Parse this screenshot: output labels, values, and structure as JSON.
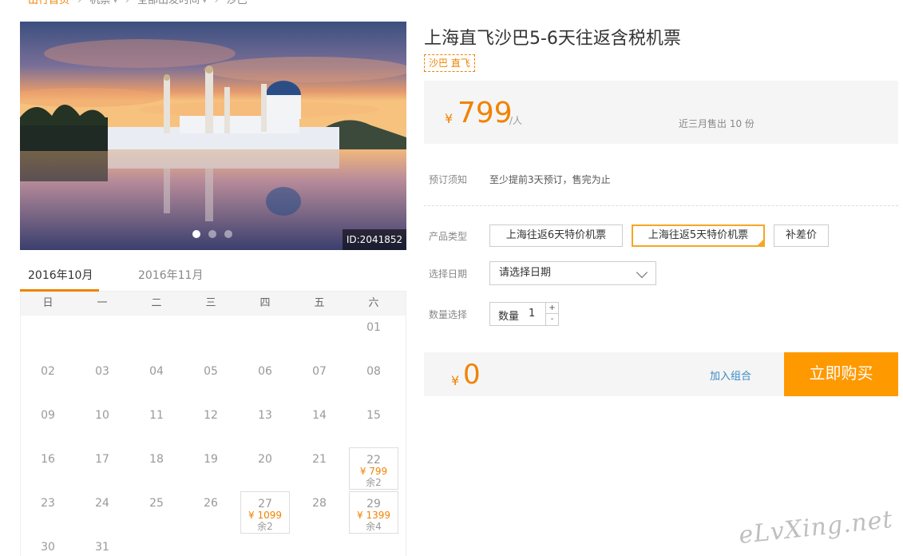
{
  "breadcrumb": {
    "items": [
      "出行首页",
      "机票",
      "全部出发时间",
      "沙巴"
    ]
  },
  "gallery": {
    "image_id": "ID:2041852",
    "dots": 3,
    "active_dot": 0
  },
  "calendar": {
    "tabs": [
      "2016年10月",
      "2016年11月"
    ],
    "active_tab": 0,
    "weekdays": [
      "日",
      "一",
      "二",
      "三",
      "四",
      "五",
      "六"
    ],
    "days": [
      {
        "d": ""
      },
      {
        "d": ""
      },
      {
        "d": ""
      },
      {
        "d": ""
      },
      {
        "d": ""
      },
      {
        "d": ""
      },
      {
        "d": "01"
      },
      {
        "d": "02"
      },
      {
        "d": "03"
      },
      {
        "d": "04"
      },
      {
        "d": "05"
      },
      {
        "d": "06"
      },
      {
        "d": "07"
      },
      {
        "d": "08"
      },
      {
        "d": "09"
      },
      {
        "d": "10"
      },
      {
        "d": "11"
      },
      {
        "d": "12"
      },
      {
        "d": "13"
      },
      {
        "d": "14"
      },
      {
        "d": "15"
      },
      {
        "d": "16"
      },
      {
        "d": "17"
      },
      {
        "d": "18"
      },
      {
        "d": "19"
      },
      {
        "d": "20"
      },
      {
        "d": "21"
      },
      {
        "d": "22",
        "price": "¥ 799",
        "left": "余2"
      },
      {
        "d": "23"
      },
      {
        "d": "24"
      },
      {
        "d": "25"
      },
      {
        "d": "26"
      },
      {
        "d": "27",
        "price": "¥ 1099",
        "left": "余2"
      },
      {
        "d": "28"
      },
      {
        "d": "29",
        "price": "¥ 1399",
        "left": "余4"
      },
      {
        "d": "30"
      },
      {
        "d": "31"
      },
      {
        "d": ""
      },
      {
        "d": ""
      },
      {
        "d": ""
      },
      {
        "d": ""
      },
      {
        "d": ""
      }
    ]
  },
  "product": {
    "title": "上海直飞沙巴5-6天往返含税机票",
    "tag": "沙巴 直飞",
    "price_symbol": "¥",
    "price": "799",
    "price_unit": "/人",
    "sold": "近三月售出 10 份",
    "notice_label": "预订须知",
    "notice": "至少提前3天预订，售完为止",
    "type_label": "产品类型",
    "types": [
      "上海往返6天特价机票",
      "上海往返5天特价机票",
      "补差价"
    ],
    "selected_type": 1,
    "date_label": "选择日期",
    "date_placeholder": "请选择日期",
    "qty_label": "数量选择",
    "qty_inner_label": "数量",
    "qty_value": "1",
    "qty_plus": "+",
    "qty_minus": "-",
    "total_symbol": "¥",
    "total": "0",
    "combo_label": "加入组合",
    "buy_label": "立即购买"
  },
  "watermark": "eLvXing.net",
  "colors": {
    "accent": "#f08300",
    "button": "#ff9900",
    "link": "#3a8ac8"
  }
}
